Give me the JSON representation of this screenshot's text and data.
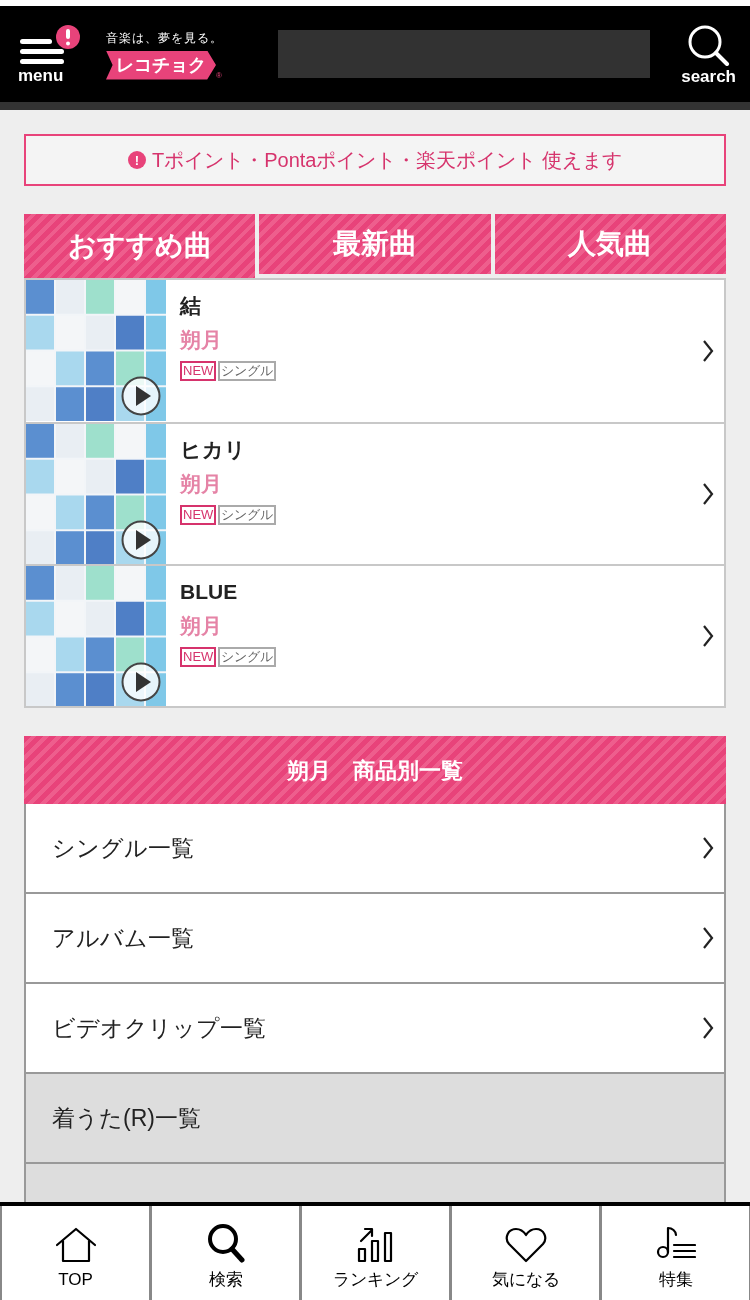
{
  "header": {
    "menu_label": "menu",
    "tagline": "音楽は、夢を見る。",
    "logo": "レコチョク",
    "logo_mark": "®",
    "search_label": "search"
  },
  "notice": {
    "icon": "!",
    "text": "Tポイント・Pontaポイント・楽天ポイント 使えます"
  },
  "tabs": [
    {
      "label": "おすすめ曲",
      "selected": true
    },
    {
      "label": "最新曲",
      "selected": false
    },
    {
      "label": "人気曲",
      "selected": false
    }
  ],
  "songs": [
    {
      "title": "結",
      "artist": "朔月",
      "new_badge": "NEW",
      "type_badge": "シングル"
    },
    {
      "title": "ヒカリ",
      "artist": "朔月",
      "new_badge": "NEW",
      "type_badge": "シングル"
    },
    {
      "title": "BLUE",
      "artist": "朔月",
      "new_badge": "NEW",
      "type_badge": "シングル"
    }
  ],
  "section": {
    "title": "朔月　商品別一覧"
  },
  "links": [
    {
      "label": "シングル一覧",
      "disabled": false
    },
    {
      "label": "アルバム一覧",
      "disabled": false
    },
    {
      "label": "ビデオクリップ一覧",
      "disabled": false
    },
    {
      "label": "着うた(R)一覧",
      "disabled": true
    },
    {
      "disabled": true
    }
  ],
  "bottom_nav": [
    {
      "kind": "home",
      "label": "TOP"
    },
    {
      "kind": "search",
      "label": "検索"
    },
    {
      "kind": "ranking",
      "label": "ランキング"
    },
    {
      "kind": "heart",
      "label": "気になる"
    },
    {
      "kind": "music",
      "label": "特集"
    }
  ]
}
